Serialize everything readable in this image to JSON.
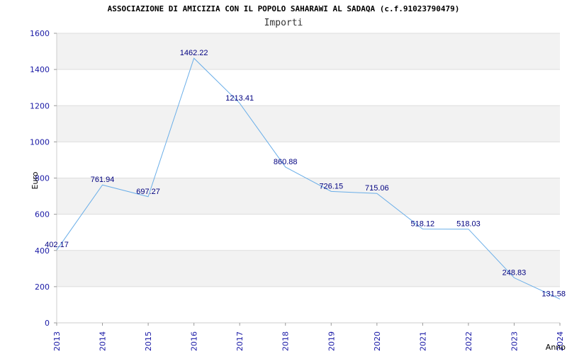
{
  "chart_data": {
    "type": "line",
    "title": "ASSOCIAZIONE DI AMICIZIA CON IL POPOLO SAHARAWI AL SADAQA (c.f.91023790479)",
    "subtitle": "Importi",
    "xlabel": "Anno",
    "ylabel": "Euro",
    "ylim": [
      0,
      1600
    ],
    "yticks": [
      "0",
      "200",
      "400",
      "600",
      "800",
      "1000",
      "1200",
      "1400",
      "1600"
    ],
    "categories": [
      "2013",
      "2014",
      "2015",
      "2016",
      "2017",
      "2018",
      "2019",
      "2020",
      "2021",
      "2022",
      "2023",
      "2024"
    ],
    "values": [
      402.17,
      761.94,
      697.27,
      1462.22,
      1213.41,
      860.88,
      726.15,
      715.06,
      518.12,
      518.03,
      248.83,
      131.58
    ],
    "data_labels": [
      "402.17",
      "761.94",
      "697.27",
      "1462.22",
      "1213.41",
      "860.88",
      "726.15",
      "715.06",
      "518.12",
      "518.03",
      "248.83",
      "131.58"
    ],
    "grid": true,
    "colors": {
      "line": "#6aaee8",
      "band": "#f2f2f2",
      "tick_text": "#1a1aa6",
      "label_text": "#000080"
    }
  }
}
